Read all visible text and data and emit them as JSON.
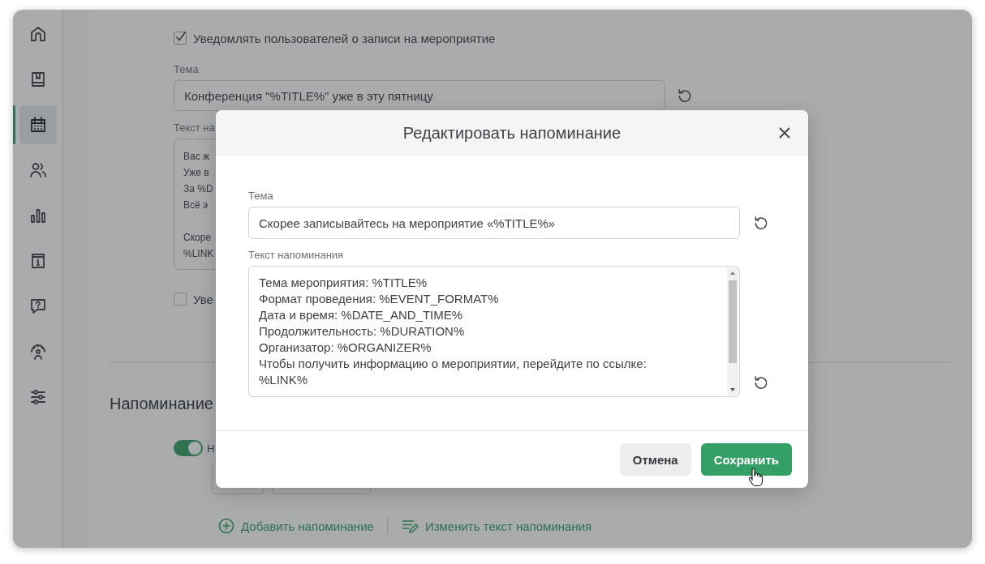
{
  "sidebar": {
    "items": [
      {
        "kind": "home",
        "selected": false
      },
      {
        "kind": "book",
        "selected": false
      },
      {
        "kind": "calendar",
        "selected": true
      },
      {
        "kind": "people",
        "selected": false
      },
      {
        "kind": "chart",
        "selected": false
      },
      {
        "kind": "info",
        "selected": false
      },
      {
        "kind": "help",
        "selected": false
      },
      {
        "kind": "gauge",
        "selected": false
      },
      {
        "kind": "sliders",
        "selected": false
      }
    ]
  },
  "notify": {
    "label": "Уведомлять пользователей о записи на мероприятие",
    "checked": true
  },
  "subject": {
    "label": "Тема",
    "value": "Конференция \"%TITLE%\" уже в эту пятницу"
  },
  "message": {
    "label": "Текст на",
    "paragraphs": [
      [
        "Вас ж",
        "Уже в",
        "За %D",
        "Всё э"
      ],
      [
        "Скоре",
        "%LINK"
      ]
    ]
  },
  "notify_second": {
    "label": "Уве",
    "checked": false
  },
  "reminders": {
    "heading": "Напоминание",
    "toggle": {
      "label": "Н",
      "on": true
    },
    "actions": [
      {
        "kind": "add",
        "label": "Добавить напоминание"
      },
      {
        "kind": "edit",
        "label": "Изменить текст напоминания"
      }
    ]
  },
  "dialog": {
    "title": "Редактировать напоминание",
    "subject": {
      "label": "Тема",
      "value": "Скорее записывайтесь на мероприятие «%TITLE%»"
    },
    "message": {
      "label": "Текст напоминания",
      "lines": [
        "Тема мероприятия: %TITLE%",
        "Формат проведения: %EVENT_FORMAT%",
        "Дата и время: %DATE_AND_TIME%",
        "Продолжительность: %DURATION%",
        "Организатор: %ORGANIZER%",
        "Чтобы получить информацию о мероприятии, перейдите по ссылке:",
        "%LINK%"
      ]
    },
    "buttons": [
      {
        "kind": "secondary",
        "label": "Отмена"
      },
      {
        "kind": "primary",
        "label": "Сохранить"
      }
    ]
  }
}
